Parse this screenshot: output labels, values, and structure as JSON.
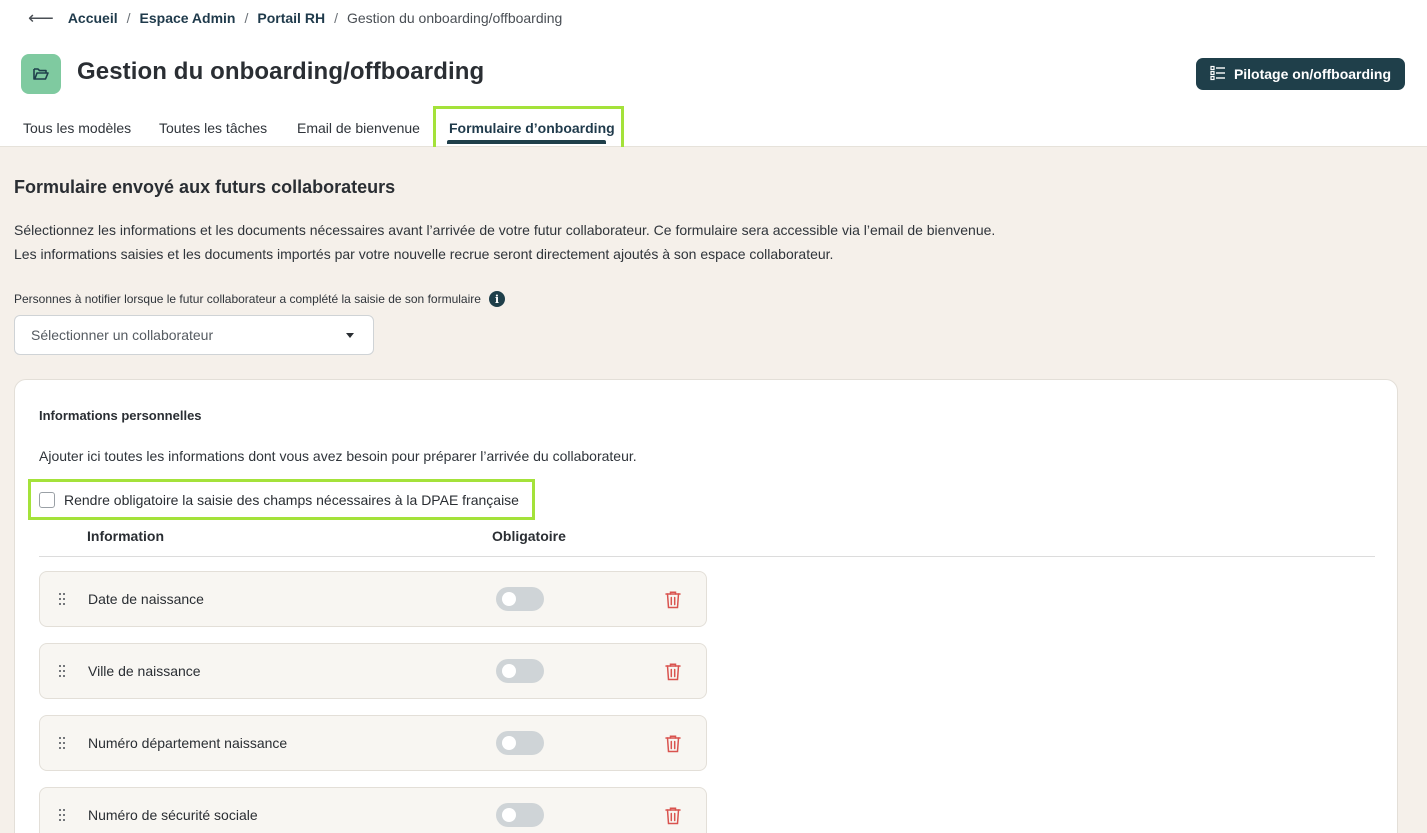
{
  "breadcrumb": {
    "items": [
      "Accueil",
      "Espace Admin",
      "Portail RH"
    ],
    "current": "Gestion du onboarding/offboarding"
  },
  "header": {
    "title": "Gestion du onboarding/offboarding",
    "pilot_button": "Pilotage on/offboarding"
  },
  "tabs": [
    {
      "label": "Tous les modèles"
    },
    {
      "label": "Toutes les tâches"
    },
    {
      "label": "Email de bienvenue"
    },
    {
      "label": "Formulaire d’onboarding",
      "active": true
    }
  ],
  "main": {
    "title": "Formulaire envoyé aux futurs collaborateurs",
    "description_line1": "Sélectionnez les informations et les documents nécessaires avant l’arrivée de votre futur collaborateur. Ce formulaire sera accessible via l’email de bienvenue.",
    "description_line2": "Les informations saisies et les documents importés par votre nouvelle recrue seront directement ajoutés à son espace collaborateur.",
    "notify_label": "Personnes à notifier lorsque le futur collaborateur a complété la saisie de son formulaire",
    "select_placeholder": "Sélectionner un collaborateur"
  },
  "card": {
    "title": "Informations personnelles",
    "description": "Ajouter ici toutes les informations dont vous avez besoin pour préparer l’arrivée du collaborateur.",
    "dpae_label": "Rendre obligatoire la saisie des champs nécessaires à la DPAE française",
    "dpae_checked": false,
    "columns": {
      "information": "Information",
      "required": "Obligatoire"
    },
    "rows": [
      {
        "label": "Date de naissance",
        "required": false
      },
      {
        "label": "Ville de naissance",
        "required": false
      },
      {
        "label": "Numéro département naissance",
        "required": false
      },
      {
        "label": "Numéro de sécurité sociale",
        "required": false
      }
    ]
  },
  "colors": {
    "accent_dark": "#1f3f4a",
    "icon_bg": "#7fcaa0",
    "highlight": "#a4e23a",
    "trash": "#d9534f",
    "content_bg": "#f5f0ea"
  }
}
